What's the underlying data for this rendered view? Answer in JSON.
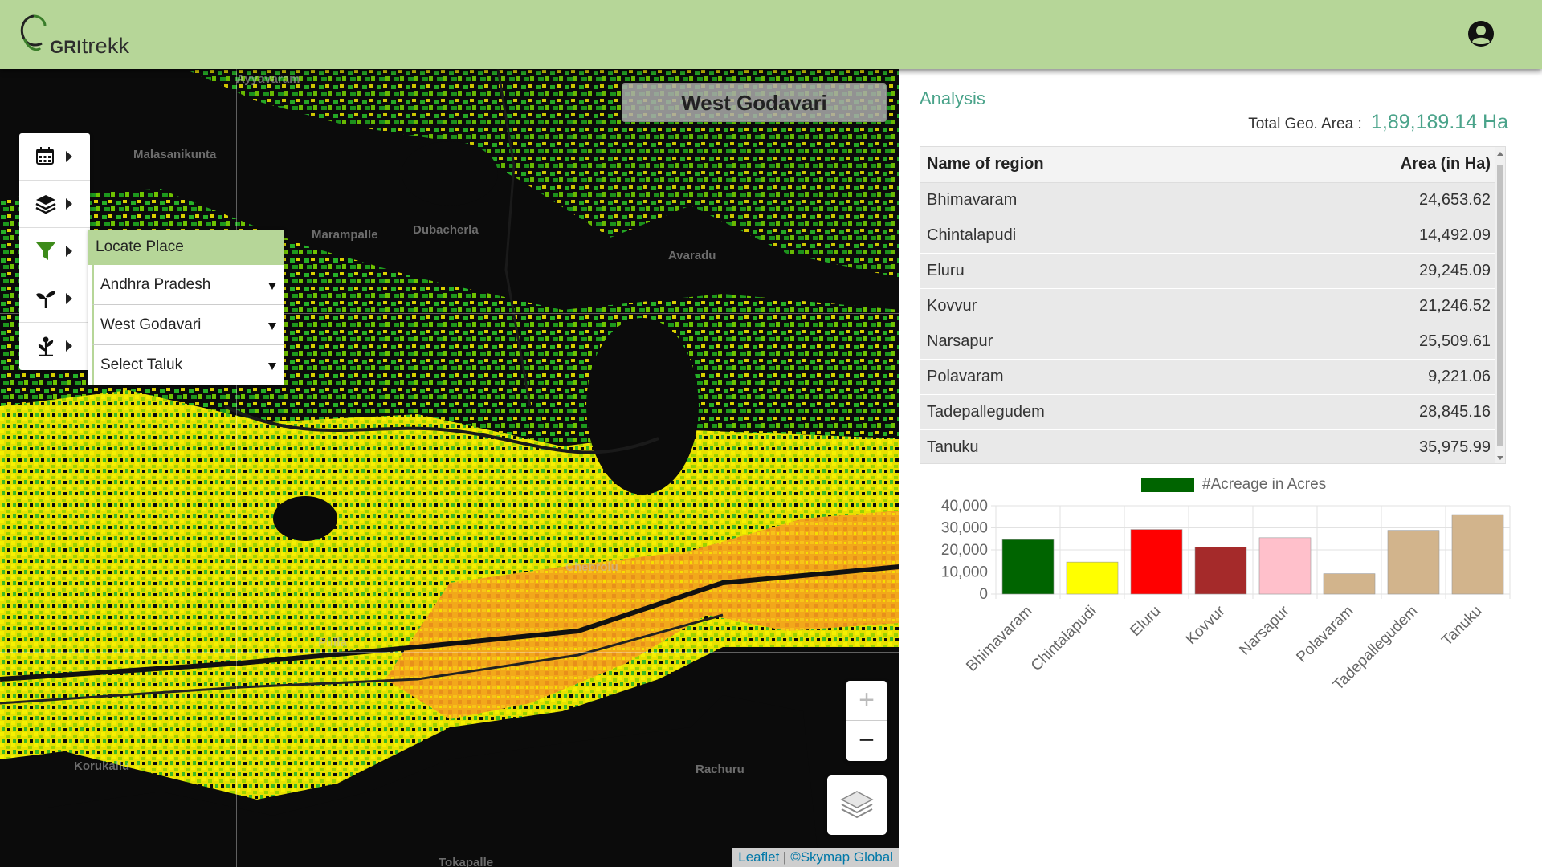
{
  "header": {
    "logo_text_bold": "GRI",
    "logo_text_rest": "trekk"
  },
  "map": {
    "region_badge": "West Godavari",
    "place_labels": [
      "Ayyavaram",
      "Malasanikunta",
      "Marampalle",
      "Dubacherla",
      "Avaradu",
      "Chebrolu",
      "Pulla",
      "Korukallu",
      "Rachuru",
      "Tokapalle"
    ],
    "locate_panel": {
      "title": "Locate Place",
      "state": "Andhra Pradesh",
      "district": "West Godavari",
      "taluk": "Select Taluk"
    },
    "toolbar_icons": [
      "calendar-icon",
      "layers-icon",
      "filter-icon",
      "sprout-icon",
      "plant-icon"
    ],
    "zoom_in": "+",
    "zoom_out": "−",
    "attribution": {
      "leaflet": "Leaflet",
      "separator": " | ",
      "skymap": "©Skymap Global"
    }
  },
  "analysis": {
    "title": "Analysis",
    "total_label": "Total Geo. Area :",
    "total_value": "1,89,189.14 Ha",
    "table": {
      "headers": [
        "Name of region",
        "Area (in Ha)"
      ],
      "rows": [
        [
          "Bhimavaram",
          "24,653.62"
        ],
        [
          "Chintalapudi",
          "14,492.09"
        ],
        [
          "Eluru",
          "29,245.09"
        ],
        [
          "Kovvur",
          "21,246.52"
        ],
        [
          "Narsapur",
          "25,509.61"
        ],
        [
          "Polavaram",
          "9,221.06"
        ],
        [
          "Tadepallegudem",
          "28,845.16"
        ],
        [
          "Tanuku",
          "35,975.99"
        ]
      ]
    }
  },
  "chart_data": {
    "type": "bar",
    "categories": [
      "Bhimavaram",
      "Chintalapudi",
      "Eluru",
      "Kovvur",
      "Narsapur",
      "Polavaram",
      "Tadepallegudem",
      "Tanuku"
    ],
    "series": [
      {
        "name": "#Acreage in Acres",
        "values": [
          24653.62,
          14492.09,
          29245.09,
          21246.52,
          25509.61,
          9221.06,
          28845.16,
          35975.99
        ],
        "colors": [
          "#006400",
          "#ffff00",
          "#ff0000",
          "#a52a2a",
          "#ffc0cb",
          "#d2b48c",
          "#d2b48c",
          "#d2b48c"
        ]
      }
    ],
    "yticks": [
      "0",
      "10,000",
      "20,000",
      "30,000",
      "40,000"
    ],
    "ylim": [
      0,
      40000
    ],
    "legend": "top",
    "grid": true
  }
}
